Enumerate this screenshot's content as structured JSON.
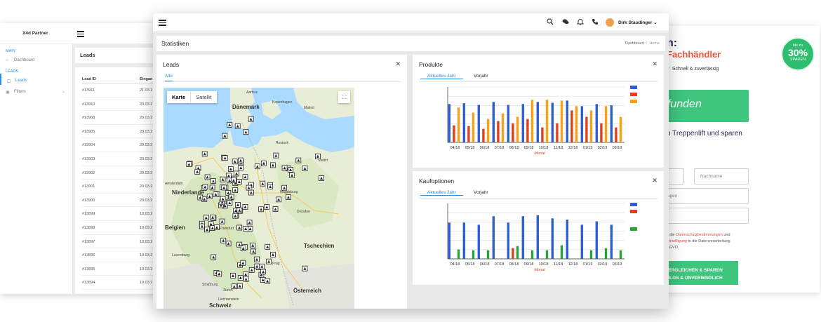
{
  "left_window": {
    "brand": "X4d Partner",
    "sidebar": [
      {
        "type": "section",
        "label": "MAIN"
      },
      {
        "type": "item",
        "label": "Dashboard",
        "icon": "home-icon",
        "active": false
      },
      {
        "type": "section",
        "label": "LEADS"
      },
      {
        "type": "item",
        "label": "Leads",
        "icon": "document-icon",
        "active": true
      },
      {
        "type": "item",
        "label": "Filtern",
        "icon": "filter-icon",
        "active": false,
        "expandable": true
      }
    ],
    "header": "Leads",
    "table": {
      "columns": [
        "Lead ID",
        "Eingan"
      ],
      "rows": [
        [
          "#13911",
          "21.03.2"
        ],
        [
          "#13910",
          "20.03.2"
        ],
        [
          "#13908",
          "20.03.2"
        ],
        [
          "#13905",
          "20.03.2"
        ],
        [
          "#13904",
          "20.03.2"
        ],
        [
          "#13903",
          "20.03.2"
        ],
        [
          "#13902",
          "20.03.2"
        ],
        [
          "#13901",
          "20.03.2"
        ],
        [
          "#13900",
          "20.03.2"
        ],
        [
          "#13899",
          "19.03.2"
        ],
        [
          "#13898",
          "19.03.2"
        ],
        [
          "#13897",
          "19.03.2"
        ],
        [
          "#13896",
          "19.03.2"
        ],
        [
          "#13895",
          "19.03.2"
        ],
        [
          "#13894",
          "19.03.2"
        ]
      ]
    }
  },
  "right_window": {
    "heading": "n:",
    "subheading": "Fachhändler",
    "check_text": "Schnell & zuverlässig",
    "badge": {
      "top": "bis zu",
      "value": "30%",
      "bottom": "SPAREN"
    },
    "green_button": "efunden",
    "tagline": "n Treppenlift und sparen",
    "fields": {
      "nachname": "Nachname",
      "anfrage": "ickfragen"
    },
    "legal": {
      "pre": "s die ",
      "link1": "Datenschutzbestimmungen",
      "mid": " und",
      "link2": "Einwilligung",
      "post": " in die Datenverarbeitung",
      "last": "SGVO."
    },
    "cta_line1": "ERGLEICHEN & SPAREN",
    "cta_line2": "ILOS & UNVERBINDLICH"
  },
  "main_window": {
    "topbar": {
      "icons": [
        "search-icon",
        "chat-icon",
        "bell-icon",
        "phone-icon"
      ],
      "user_name": "Dirk Staudinger"
    },
    "page_title": "Statistiken",
    "breadcrumb": [
      "Dashboard",
      "Home"
    ],
    "leads_card": {
      "title": "Leads",
      "tabs": [
        "Alle"
      ],
      "map": {
        "toggle": [
          "Karte",
          "Satellit"
        ],
        "labels": [
          {
            "text": "Dänemark",
            "type": "country"
          },
          {
            "text": "Kopenhagen",
            "type": "city"
          },
          {
            "text": "Malmö",
            "type": "city"
          },
          {
            "text": "Aarhus",
            "type": "city"
          },
          {
            "text": "Rostock",
            "type": "city"
          },
          {
            "text": "Stettin",
            "type": "city"
          },
          {
            "text": "Amsterdam",
            "type": "city"
          },
          {
            "text": "Niederlande",
            "type": "country"
          },
          {
            "text": "Magdeburg",
            "type": "city"
          },
          {
            "text": "Dresden",
            "type": "city"
          },
          {
            "text": "Belgien",
            "type": "country"
          },
          {
            "text": "Frankfurt",
            "type": "city"
          },
          {
            "text": "Tschechien",
            "type": "country"
          },
          {
            "text": "Luxemburg",
            "type": "city"
          },
          {
            "text": "Prag",
            "type": "city"
          },
          {
            "text": "Straßburg",
            "type": "city"
          },
          {
            "text": "Zürich",
            "type": "city"
          },
          {
            "text": "Österreich",
            "type": "country"
          },
          {
            "text": "Liechtenstein",
            "type": "city"
          },
          {
            "text": "Schweiz",
            "type": "country"
          }
        ]
      }
    },
    "produkte_card": {
      "title": "Produkte",
      "tabs": [
        "Aktuelles Jahr",
        "Vorjahr"
      ]
    },
    "kauf_card": {
      "title": "Kaufoptionen",
      "tabs": [
        "Aktuelles Jahr",
        "Vorjahr"
      ]
    },
    "colors": {
      "blue": "#2f5fd0",
      "red": "#e0401c",
      "orange": "#f7a21b",
      "green": "#27a33a",
      "accent": "#2a8de0"
    }
  },
  "chart_data": [
    {
      "type": "bar",
      "title": "",
      "categories": [
        "04/18",
        "05/18",
        "06/18",
        "07/18",
        "08/18",
        "09/18",
        "10/18",
        "11/18",
        "12/18",
        "01/19",
        "02/19",
        "03/19"
      ],
      "xlabel": "Monat",
      "series": [
        {
          "color": "#2f5fd0",
          "values": [
            90,
            92,
            88,
            95,
            88,
            90,
            95,
            93,
            98,
            85,
            90,
            87
          ]
        },
        {
          "color": "#e0401c",
          "values": [
            40,
            38,
            32,
            50,
            45,
            55,
            35,
            45,
            75,
            60,
            45,
            35
          ]
        },
        {
          "color": "#f7a21b",
          "values": [
            82,
            70,
            55,
            68,
            60,
            100,
            100,
            98,
            85,
            75,
            85,
            60
          ]
        }
      ],
      "ylim": [
        0,
        130
      ]
    },
    {
      "type": "bar",
      "title": "",
      "categories": [
        "04/18",
        "05/18",
        "06/18",
        "07/18",
        "08/18",
        "09/18",
        "10/18",
        "11/18",
        "12/18",
        "01/19",
        "02/19",
        "03/19"
      ],
      "xlabel": "Monat",
      "series": [
        {
          "color": "#2f5fd0",
          "values": [
            85,
            85,
            80,
            100,
            85,
            100,
            102,
            95,
            92,
            80,
            88,
            80
          ]
        },
        {
          "color": "#e0401c",
          "values": [
            0,
            0,
            0,
            0,
            25,
            0,
            0,
            0,
            0,
            0,
            0,
            0
          ]
        },
        {
          "color": "#27a33a",
          "values": [
            22,
            20,
            20,
            0,
            30,
            20,
            20,
            32,
            0,
            20,
            25,
            20
          ]
        }
      ],
      "ylim": [
        0,
        130
      ]
    }
  ]
}
